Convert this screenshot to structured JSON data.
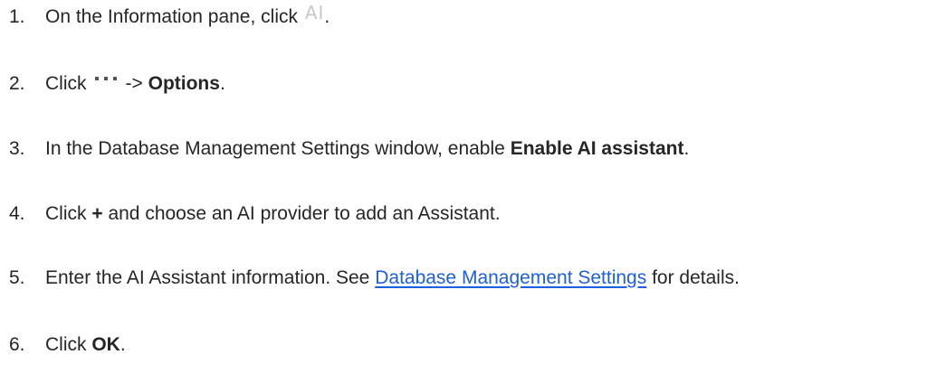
{
  "steps": [
    {
      "num": "1.",
      "text_a": "On the Information pane, click",
      "icon_glyph": "AI",
      "icon": "ai-icon",
      "text_b": "."
    },
    {
      "num": "2.",
      "text_a": "Click",
      "icon": "more-dots-icon",
      "text_b": "->",
      "bold": "Options",
      "text_c": "."
    },
    {
      "num": "3.",
      "text_a": "In the Database Management Settings window, enable",
      "bold": "Enable AI assistant",
      "text_b": "."
    },
    {
      "num": "4.",
      "text_a": "Click",
      "bold": "+",
      "text_b": "and choose an AI provider to add an Assistant."
    },
    {
      "num": "5.",
      "text_a": "Enter the AI Assistant information. See",
      "link": "Database Management Settings",
      "text_b": "for details."
    },
    {
      "num": "6.",
      "text_a": "Click",
      "bold": "OK",
      "text_b": "."
    }
  ],
  "colors": {
    "text": "#262626",
    "link": "#1f5ee0",
    "icon": "#c8c8c8",
    "dots": "#555555"
  }
}
